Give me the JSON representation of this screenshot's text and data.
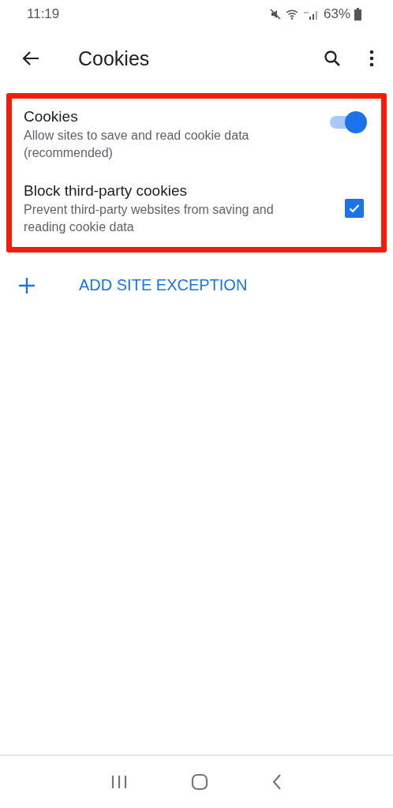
{
  "status_bar": {
    "time": "11:19",
    "battery": "63%"
  },
  "toolbar": {
    "title": "Cookies"
  },
  "settings": [
    {
      "kind": "toggle",
      "title": "Cookies",
      "summary": "Allow sites to save and read cookie data (recommended)",
      "on": true
    },
    {
      "kind": "checkbox",
      "title": "Block third-party cookies",
      "summary": "Prevent third-party websites from saving and reading cookie data",
      "checked": true
    }
  ],
  "add_exception": {
    "label": "ADD SITE EXCEPTION"
  }
}
